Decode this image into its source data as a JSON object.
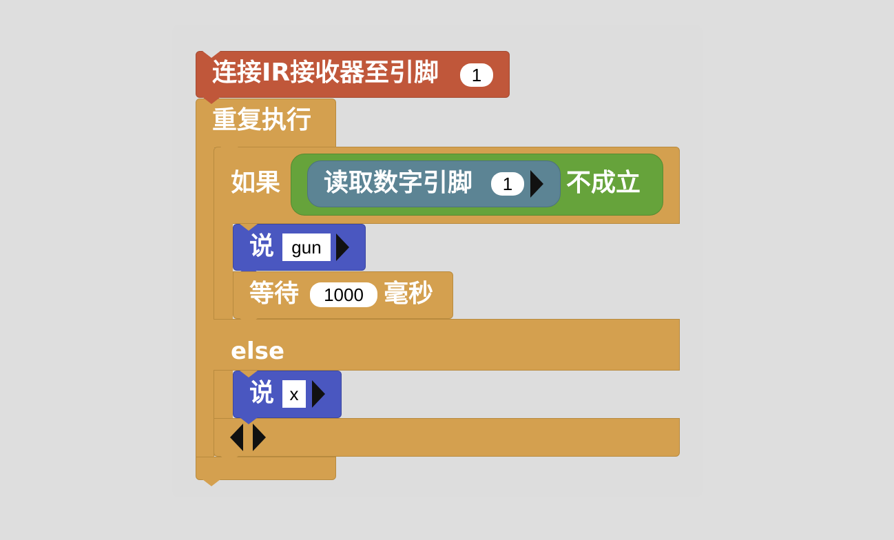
{
  "colors": {
    "background": "#dedede",
    "control": "#d4a04f",
    "control_border": "#b88a3e",
    "ir_block": "#c0573a",
    "logic_not": "#66a33b",
    "digital_read": "#5c8494",
    "say_block": "#4a57c0"
  },
  "blocks": {
    "ir_setup": {
      "label": "连接IR接收器至引脚",
      "pin": "1"
    },
    "forever": {
      "label": "重复执行"
    },
    "if_else": {
      "if_label": "如果",
      "else_label": "else",
      "condition": {
        "digital_read_label": "读取数字引脚",
        "pin": "1",
        "not_label": "不成立"
      },
      "then": {
        "say": {
          "label": "说",
          "value": "gun"
        },
        "wait": {
          "label": "等待",
          "value": "1000",
          "unit": "毫秒"
        }
      },
      "else_body": {
        "say": {
          "label": "说",
          "value": "x"
        }
      }
    }
  },
  "icons": [
    "dropdown-arrow-icon",
    "mutator-left-arrow-icon",
    "mutator-right-arrow-icon"
  ]
}
